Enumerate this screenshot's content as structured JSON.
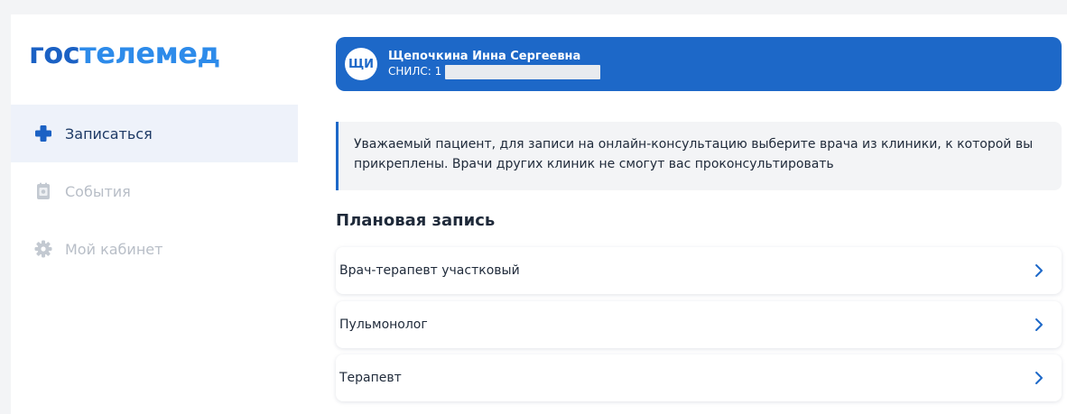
{
  "logo": {
    "part1": "гос",
    "part2": "телемед"
  },
  "sidebar": {
    "items": [
      {
        "label": "Записаться",
        "icon": "medical-cross-icon",
        "active": true
      },
      {
        "label": "События",
        "icon": "calendar-icon",
        "active": false
      },
      {
        "label": "Мой кабинет",
        "icon": "gear-icon",
        "active": false
      }
    ]
  },
  "user": {
    "initials": "ЩИ",
    "name": "Щепочкина Инна Сергеевна",
    "snils_label": "СНИЛС: 1"
  },
  "notice": {
    "text": "Уважаемый пациент, для записи на онлайн-консультацию выберите врача из клиники, к которой вы прикреплены. Врачи других клиник не смогут вас проконсультировать"
  },
  "section": {
    "title": "Плановая запись"
  },
  "specialists": [
    {
      "label": "Врач-терапевт участковый"
    },
    {
      "label": "Пульмонолог"
    },
    {
      "label": "Терапевт"
    }
  ],
  "colors": {
    "brand": "#1b61c4",
    "brand_light": "#2d8bea",
    "card": "#1d68c8",
    "active_bg": "#eef2fa"
  }
}
